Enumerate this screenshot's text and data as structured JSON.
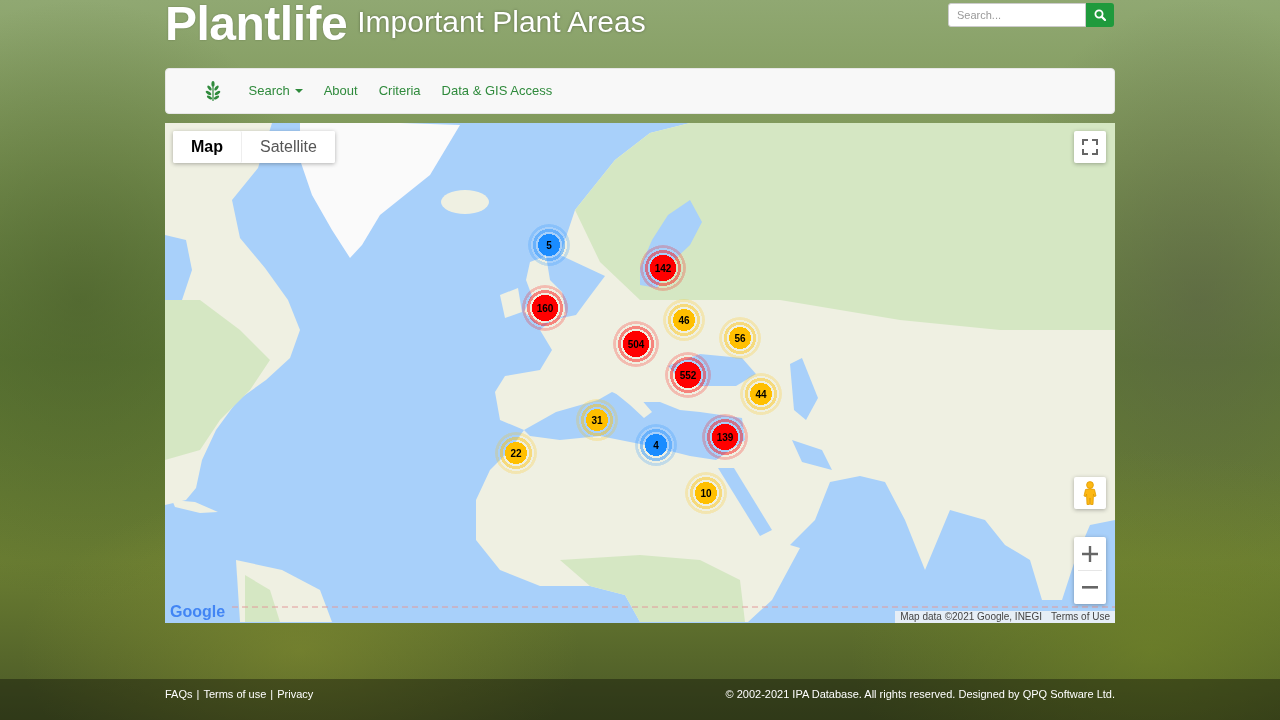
{
  "header": {
    "logo": "Plantlife",
    "title": "Important Plant Areas",
    "search": {
      "placeholder": "Search..."
    }
  },
  "navbar": {
    "items": [
      {
        "label": "Search",
        "kind": "dropdown"
      },
      {
        "label": "About",
        "kind": "link"
      },
      {
        "label": "Criteria",
        "kind": "link"
      },
      {
        "label": "Data & GIS Access",
        "kind": "link"
      }
    ]
  },
  "map": {
    "map_types": [
      {
        "label": "Map",
        "selected": true
      },
      {
        "label": "Satellite",
        "selected": false
      }
    ],
    "clusters": [
      {
        "count": "5",
        "color": "#1a8cff"
      },
      {
        "count": "142",
        "color": "#ff0000"
      },
      {
        "count": "160",
        "color": "#ff0000"
      },
      {
        "count": "46",
        "color": "#ffbf00"
      },
      {
        "count": "56",
        "color": "#ffbf00"
      },
      {
        "count": "504",
        "color": "#ff0000"
      },
      {
        "count": "552",
        "color": "#ff0000"
      },
      {
        "count": "44",
        "color": "#ffbf00"
      },
      {
        "count": "31",
        "color": "#ffbf00"
      },
      {
        "count": "139",
        "color": "#ff0000"
      },
      {
        "count": "4",
        "color": "#1a8cff"
      },
      {
        "count": "22",
        "color": "#ffbf00"
      },
      {
        "count": "10",
        "color": "#ffbf00"
      }
    ],
    "logo": "Google",
    "attribution": "Map data ©2021 Google, INEGI",
    "terms": "Terms of Use"
  },
  "footer": {
    "links": [
      "FAQs",
      "Terms of use",
      "Privacy"
    ],
    "separators": [
      "|",
      "|"
    ],
    "copyright": "© 2002-2021 IPA Database. All rights reserved. Designed by QPQ Software Ltd."
  }
}
